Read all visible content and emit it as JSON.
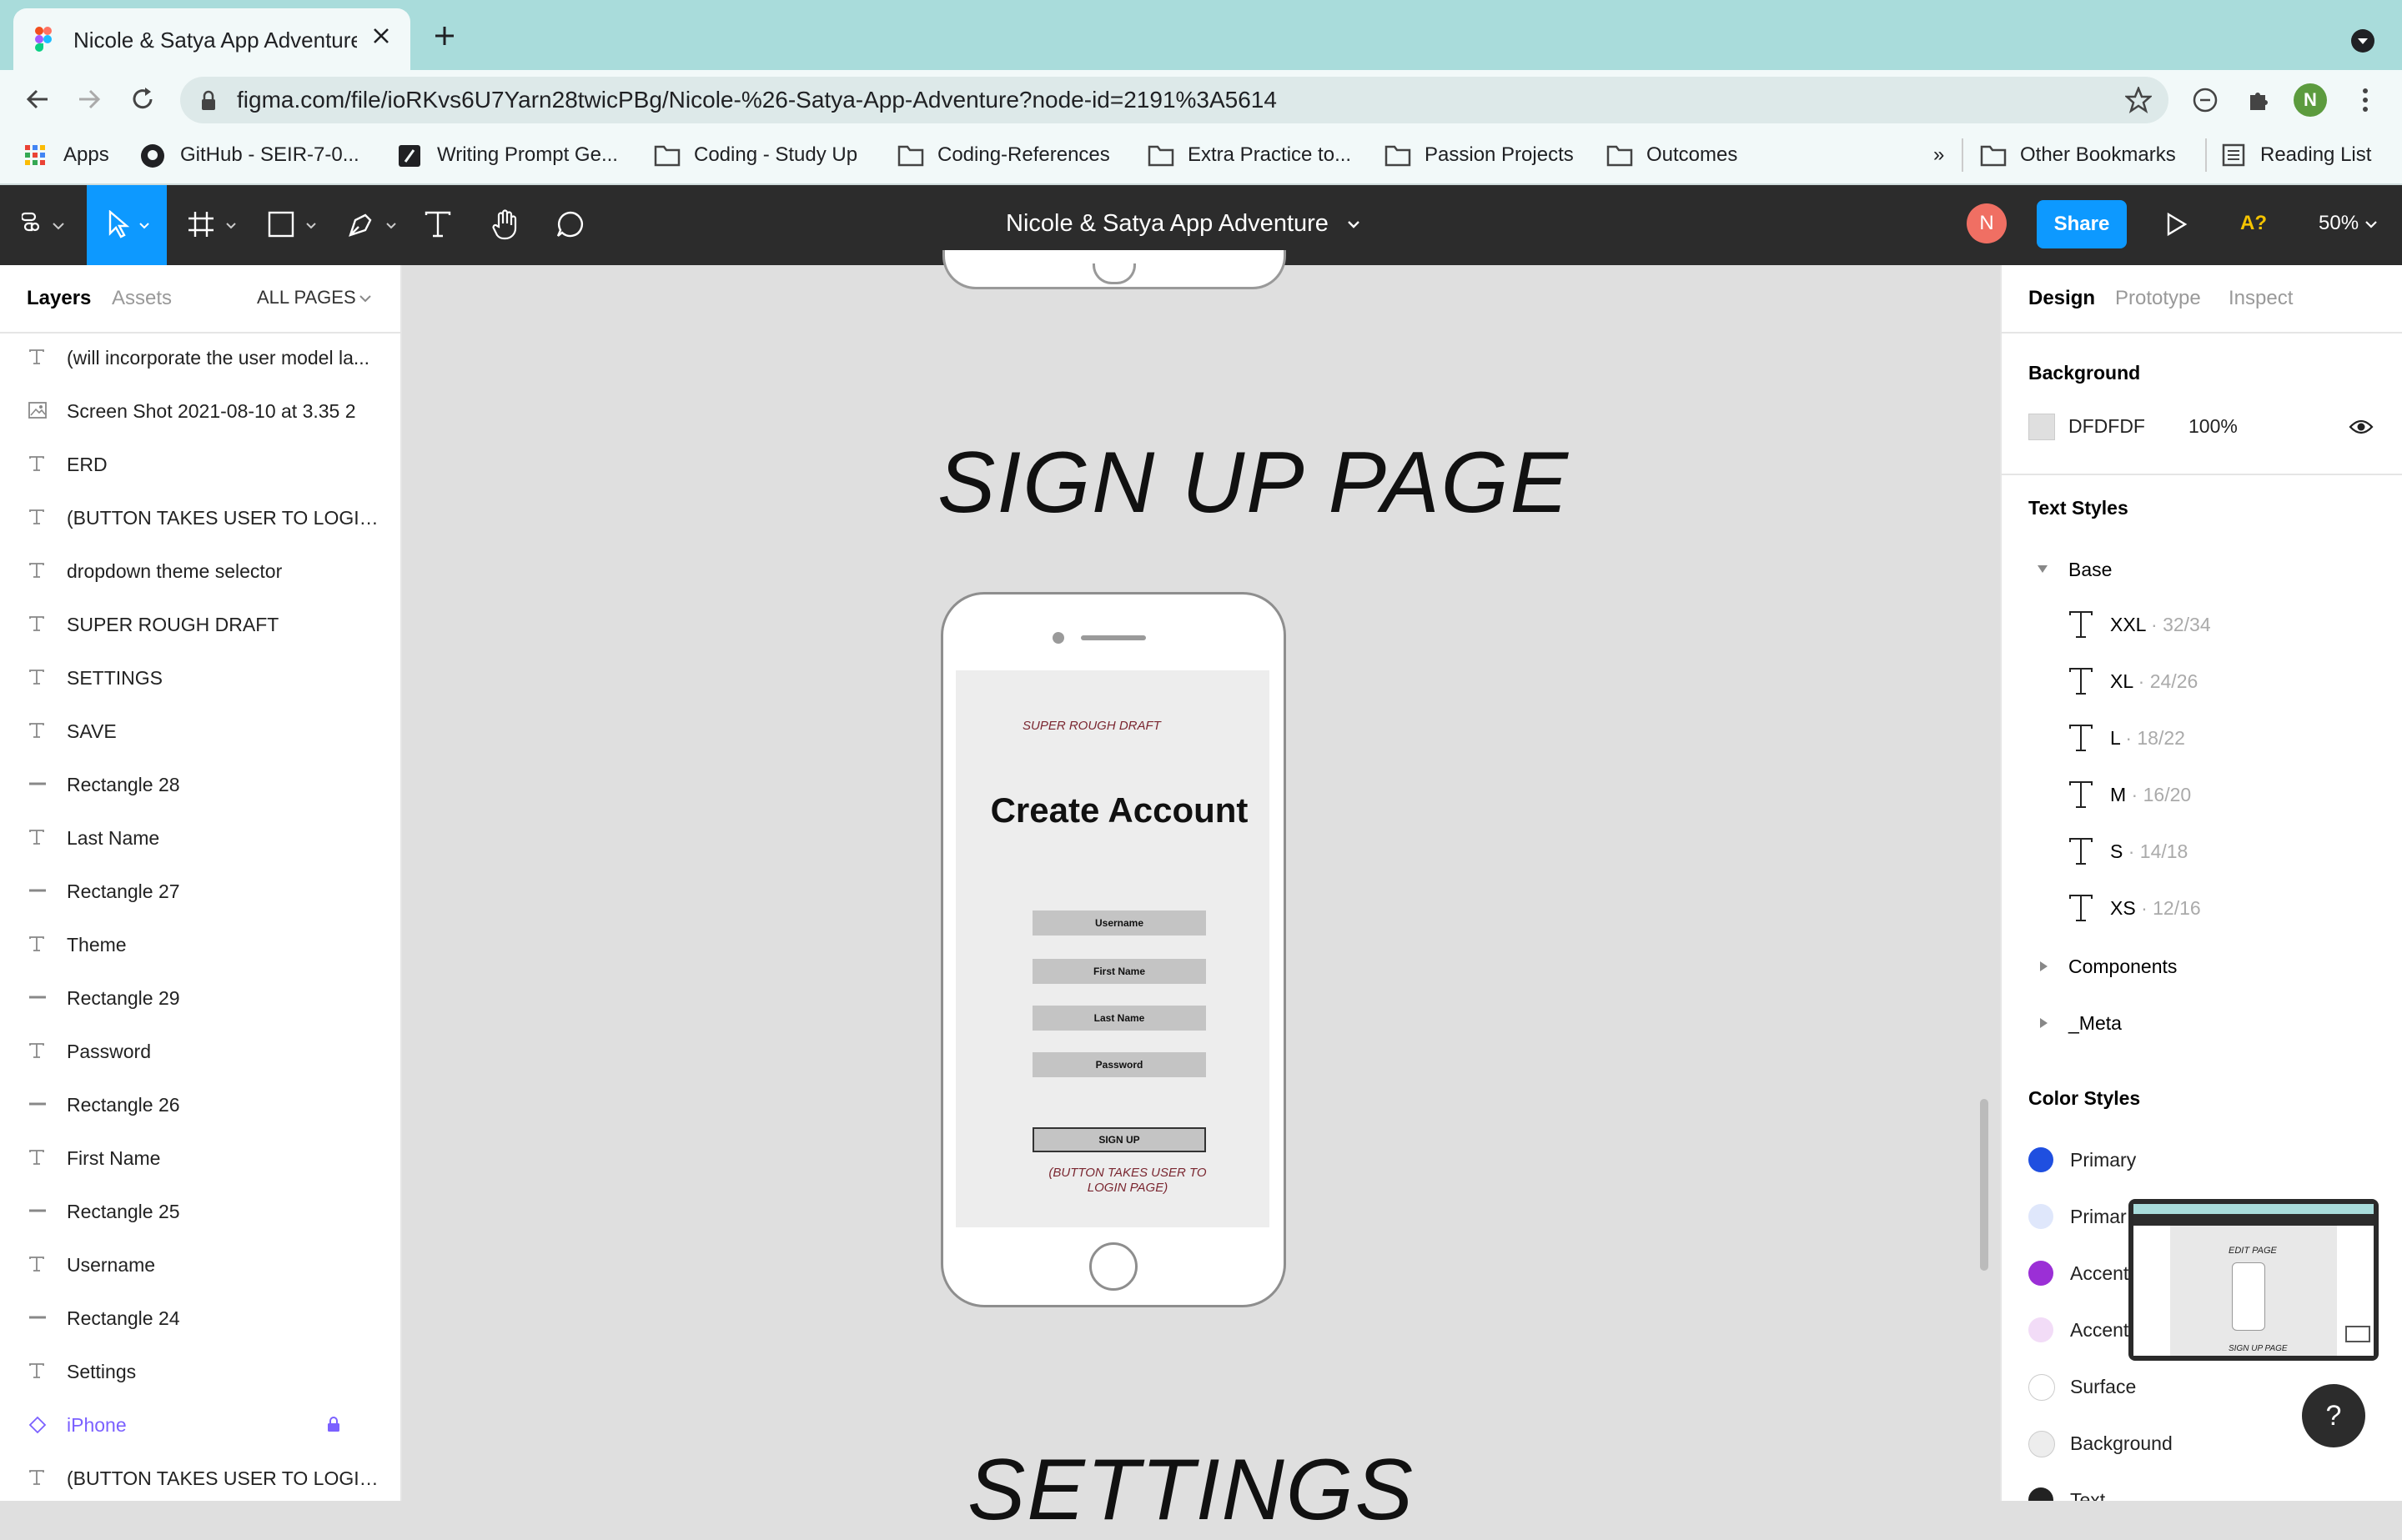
{
  "browser": {
    "tab_title": "Nicole & Satya App Adventure",
    "url": "figma.com/file/ioRKvs6U7Yarn28twicPBg/Nicole-%26-Satya-App-Adventure?node-id=2191%3A5614",
    "profile_initial": "N",
    "bookmarks": [
      "Apps",
      "GitHub - SEIR-7-0...",
      "Writing Prompt Ge...",
      "Coding - Study Up",
      "Coding-References",
      "Extra Practice to...",
      "Passion Projects",
      "Outcomes"
    ],
    "overflow": "»",
    "other_bookmarks": "Other Bookmarks",
    "reading_list": "Reading List"
  },
  "figma": {
    "file_title": "Nicole & Satya App Adventure",
    "user_initial": "N",
    "share_label": "Share",
    "missing_fonts": "A?",
    "zoom": "50%"
  },
  "left_panel": {
    "tab_layers": "Layers",
    "tab_assets": "Assets",
    "pages_label": "ALL PAGES",
    "layers": [
      {
        "name": "(will incorporate the user model la...",
        "kind": "text"
      },
      {
        "name": "Screen Shot 2021-08-10 at 3.35 2",
        "kind": "image"
      },
      {
        "name": "ERD",
        "kind": "text"
      },
      {
        "name": "(BUTTON TAKES USER TO LOGIN ...",
        "kind": "text"
      },
      {
        "name": "dropdown theme selector",
        "kind": "text"
      },
      {
        "name": "SUPER ROUGH DRAFT",
        "kind": "text"
      },
      {
        "name": "SETTINGS",
        "kind": "text"
      },
      {
        "name": "SAVE",
        "kind": "text"
      },
      {
        "name": "Rectangle 28",
        "kind": "rect"
      },
      {
        "name": "Last Name",
        "kind": "text"
      },
      {
        "name": "Rectangle 27",
        "kind": "rect"
      },
      {
        "name": "Theme",
        "kind": "text"
      },
      {
        "name": "Rectangle 29",
        "kind": "rect"
      },
      {
        "name": "Password",
        "kind": "text"
      },
      {
        "name": "Rectangle 26",
        "kind": "rect"
      },
      {
        "name": "First Name",
        "kind": "text"
      },
      {
        "name": "Rectangle 25",
        "kind": "rect"
      },
      {
        "name": "Username",
        "kind": "text"
      },
      {
        "name": "Rectangle 24",
        "kind": "rect"
      },
      {
        "name": "Settings",
        "kind": "text"
      },
      {
        "name": "iPhone",
        "kind": "component"
      },
      {
        "name": "(BUTTON TAKES USER TO LOGIN ...",
        "kind": "text"
      }
    ]
  },
  "canvas": {
    "heading_signup": "SIGN UP PAGE",
    "heading_settings": "SETTINGS",
    "draft_label": "SUPER ROUGH DRAFT",
    "create_account": "Create Account",
    "fields": [
      "Username",
      "First Name",
      "Last Name",
      "Password"
    ],
    "signup_button": "SIGN UP",
    "button_note": "(BUTTON TAKES USER TO LOGIN PAGE)"
  },
  "right_panel": {
    "tab_design": "Design",
    "tab_prototype": "Prototype",
    "tab_inspect": "Inspect",
    "background_title": "Background",
    "background_hex": "DFDFDF",
    "background_opacity": "100%",
    "text_styles_title": "Text Styles",
    "base_group": "Base",
    "text_styles": [
      {
        "name": "XXL",
        "size": " · 32/34"
      },
      {
        "name": "XL",
        "size": " · 24/26"
      },
      {
        "name": "L",
        "size": " · 18/22"
      },
      {
        "name": "M",
        "size": " · 16/20"
      },
      {
        "name": "S",
        "size": " · 14/18"
      },
      {
        "name": "XS",
        "size": " · 12/16"
      }
    ],
    "components_group": "Components",
    "meta_group": "_Meta",
    "color_styles_title": "Color Styles",
    "color_styles": [
      {
        "name": "Primary",
        "color": "#1f4fe0"
      },
      {
        "name": "Primar",
        "color": "#dfe7fb"
      },
      {
        "name": "Accent",
        "color": "#9b2fd6"
      },
      {
        "name": "Accent",
        "color": "#f2dcf7"
      },
      {
        "name": "Surface",
        "color": "#ffffff"
      },
      {
        "name": "Background",
        "color": "#ededed"
      },
      {
        "name": "Text",
        "color": "#222222"
      }
    ],
    "thumb_edit": "EDIT PAGE",
    "thumb_signup": "SIGN UP PAGE",
    "help": "?"
  }
}
